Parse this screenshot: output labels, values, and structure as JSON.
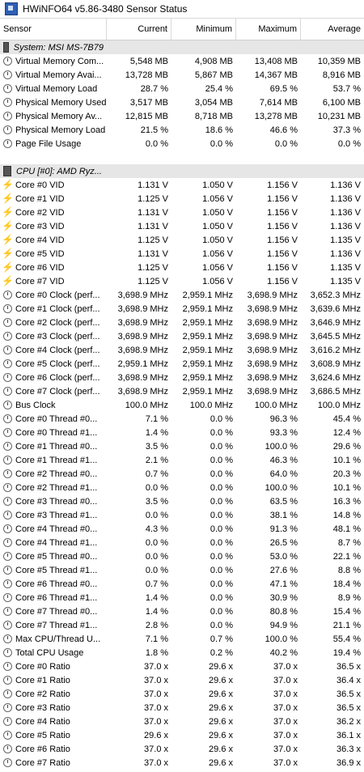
{
  "window": {
    "title": "HWiNFO64 v5.86-3480 Sensor Status"
  },
  "columns": {
    "sensor": "Sensor",
    "current": "Current",
    "minimum": "Minimum",
    "maximum": "Maximum",
    "average": "Average"
  },
  "rows": [
    {
      "type": "group",
      "label": "System: MSI MS-7B79"
    },
    {
      "type": "data",
      "icon": "clock-icon",
      "label": "Virtual Memory Com...",
      "current": "5,548 MB",
      "minimum": "4,908 MB",
      "maximum": "13,408 MB",
      "average": "10,359 MB"
    },
    {
      "type": "data",
      "icon": "clock-icon",
      "label": "Virtual Memory Avai...",
      "current": "13,728 MB",
      "minimum": "5,867 MB",
      "maximum": "14,367 MB",
      "average": "8,916 MB"
    },
    {
      "type": "data",
      "icon": "clock-icon",
      "label": "Virtual Memory Load",
      "current": "28.7 %",
      "minimum": "25.4 %",
      "maximum": "69.5 %",
      "average": "53.7 %"
    },
    {
      "type": "data",
      "icon": "clock-icon",
      "label": "Physical Memory Used",
      "current": "3,517 MB",
      "minimum": "3,054 MB",
      "maximum": "7,614 MB",
      "average": "6,100 MB"
    },
    {
      "type": "data",
      "icon": "clock-icon",
      "label": "Physical Memory Av...",
      "current": "12,815 MB",
      "minimum": "8,718 MB",
      "maximum": "13,278 MB",
      "average": "10,231 MB"
    },
    {
      "type": "data",
      "icon": "clock-icon",
      "label": "Physical Memory Load",
      "current": "21.5 %",
      "minimum": "18.6 %",
      "maximum": "46.6 %",
      "average": "37.3 %"
    },
    {
      "type": "data",
      "icon": "clock-icon",
      "label": "Page File Usage",
      "current": "0.0 %",
      "minimum": "0.0 %",
      "maximum": "0.0 %",
      "average": "0.0 %"
    },
    {
      "type": "blank"
    },
    {
      "type": "group",
      "label": "CPU [#0]: AMD Ryz..."
    },
    {
      "type": "data",
      "icon": "bolt-icon",
      "label": "Core #0 VID",
      "current": "1.131 V",
      "minimum": "1.050 V",
      "maximum": "1.156 V",
      "average": "1.136 V"
    },
    {
      "type": "data",
      "icon": "bolt-icon",
      "label": "Core #1 VID",
      "current": "1.125 V",
      "minimum": "1.056 V",
      "maximum": "1.156 V",
      "average": "1.136 V"
    },
    {
      "type": "data",
      "icon": "bolt-icon",
      "label": "Core #2 VID",
      "current": "1.131 V",
      "minimum": "1.050 V",
      "maximum": "1.156 V",
      "average": "1.136 V"
    },
    {
      "type": "data",
      "icon": "bolt-icon",
      "label": "Core #3 VID",
      "current": "1.131 V",
      "minimum": "1.050 V",
      "maximum": "1.156 V",
      "average": "1.136 V"
    },
    {
      "type": "data",
      "icon": "bolt-icon",
      "label": "Core #4 VID",
      "current": "1.125 V",
      "minimum": "1.050 V",
      "maximum": "1.156 V",
      "average": "1.135 V"
    },
    {
      "type": "data",
      "icon": "bolt-icon",
      "label": "Core #5 VID",
      "current": "1.131 V",
      "minimum": "1.056 V",
      "maximum": "1.156 V",
      "average": "1.136 V"
    },
    {
      "type": "data",
      "icon": "bolt-icon",
      "label": "Core #6 VID",
      "current": "1.125 V",
      "minimum": "1.056 V",
      "maximum": "1.156 V",
      "average": "1.135 V"
    },
    {
      "type": "data",
      "icon": "bolt-icon",
      "label": "Core #7 VID",
      "current": "1.125 V",
      "minimum": "1.056 V",
      "maximum": "1.156 V",
      "average": "1.135 V"
    },
    {
      "type": "data",
      "icon": "clock-icon",
      "label": "Core #0 Clock (perf...",
      "current": "3,698.9 MHz",
      "minimum": "2,959.1 MHz",
      "maximum": "3,698.9 MHz",
      "average": "3,652.3 MHz"
    },
    {
      "type": "data",
      "icon": "clock-icon",
      "label": "Core #1 Clock (perf...",
      "current": "3,698.9 MHz",
      "minimum": "2,959.1 MHz",
      "maximum": "3,698.9 MHz",
      "average": "3,639.6 MHz"
    },
    {
      "type": "data",
      "icon": "clock-icon",
      "label": "Core #2 Clock (perf...",
      "current": "3,698.9 MHz",
      "minimum": "2,959.1 MHz",
      "maximum": "3,698.9 MHz",
      "average": "3,646.9 MHz"
    },
    {
      "type": "data",
      "icon": "clock-icon",
      "label": "Core #3 Clock (perf...",
      "current": "3,698.9 MHz",
      "minimum": "2,959.1 MHz",
      "maximum": "3,698.9 MHz",
      "average": "3,645.5 MHz"
    },
    {
      "type": "data",
      "icon": "clock-icon",
      "label": "Core #4 Clock (perf...",
      "current": "3,698.9 MHz",
      "minimum": "2,959.1 MHz",
      "maximum": "3,698.9 MHz",
      "average": "3,616.2 MHz"
    },
    {
      "type": "data",
      "icon": "clock-icon",
      "label": "Core #5 Clock (perf...",
      "current": "2,959.1 MHz",
      "minimum": "2,959.1 MHz",
      "maximum": "3,698.9 MHz",
      "average": "3,608.9 MHz"
    },
    {
      "type": "data",
      "icon": "clock-icon",
      "label": "Core #6 Clock (perf...",
      "current": "3,698.9 MHz",
      "minimum": "2,959.1 MHz",
      "maximum": "3,698.9 MHz",
      "average": "3,624.6 MHz"
    },
    {
      "type": "data",
      "icon": "clock-icon",
      "label": "Core #7 Clock (perf...",
      "current": "3,698.9 MHz",
      "minimum": "2,959.1 MHz",
      "maximum": "3,698.9 MHz",
      "average": "3,686.5 MHz"
    },
    {
      "type": "data",
      "icon": "clock-icon",
      "label": "Bus Clock",
      "current": "100.0 MHz",
      "minimum": "100.0 MHz",
      "maximum": "100.0 MHz",
      "average": "100.0 MHz"
    },
    {
      "type": "data",
      "icon": "clock-icon",
      "label": "Core #0 Thread #0...",
      "current": "7.1 %",
      "minimum": "0.0 %",
      "maximum": "96.3 %",
      "average": "45.4 %"
    },
    {
      "type": "data",
      "icon": "clock-icon",
      "label": "Core #0 Thread #1...",
      "current": "1.4 %",
      "minimum": "0.0 %",
      "maximum": "93.3 %",
      "average": "12.4 %"
    },
    {
      "type": "data",
      "icon": "clock-icon",
      "label": "Core #1 Thread #0...",
      "current": "3.5 %",
      "minimum": "0.0 %",
      "maximum": "100.0 %",
      "average": "29.6 %"
    },
    {
      "type": "data",
      "icon": "clock-icon",
      "label": "Core #1 Thread #1...",
      "current": "2.1 %",
      "minimum": "0.0 %",
      "maximum": "46.3 %",
      "average": "10.1 %"
    },
    {
      "type": "data",
      "icon": "clock-icon",
      "label": "Core #2 Thread #0...",
      "current": "0.7 %",
      "minimum": "0.0 %",
      "maximum": "64.0 %",
      "average": "20.3 %"
    },
    {
      "type": "data",
      "icon": "clock-icon",
      "label": "Core #2 Thread #1...",
      "current": "0.0 %",
      "minimum": "0.0 %",
      "maximum": "100.0 %",
      "average": "10.1 %"
    },
    {
      "type": "data",
      "icon": "clock-icon",
      "label": "Core #3 Thread #0...",
      "current": "3.5 %",
      "minimum": "0.0 %",
      "maximum": "63.5 %",
      "average": "16.3 %"
    },
    {
      "type": "data",
      "icon": "clock-icon",
      "label": "Core #3 Thread #1...",
      "current": "0.0 %",
      "minimum": "0.0 %",
      "maximum": "38.1 %",
      "average": "14.8 %"
    },
    {
      "type": "data",
      "icon": "clock-icon",
      "label": "Core #4 Thread #0...",
      "current": "4.3 %",
      "minimum": "0.0 %",
      "maximum": "91.3 %",
      "average": "48.1 %"
    },
    {
      "type": "data",
      "icon": "clock-icon",
      "label": "Core #4 Thread #1...",
      "current": "0.0 %",
      "minimum": "0.0 %",
      "maximum": "26.5 %",
      "average": "8.7 %"
    },
    {
      "type": "data",
      "icon": "clock-icon",
      "label": "Core #5 Thread #0...",
      "current": "0.0 %",
      "minimum": "0.0 %",
      "maximum": "53.0 %",
      "average": "22.1 %"
    },
    {
      "type": "data",
      "icon": "clock-icon",
      "label": "Core #5 Thread #1...",
      "current": "0.0 %",
      "minimum": "0.0 %",
      "maximum": "27.6 %",
      "average": "8.8 %"
    },
    {
      "type": "data",
      "icon": "clock-icon",
      "label": "Core #6 Thread #0...",
      "current": "0.7 %",
      "minimum": "0.0 %",
      "maximum": "47.1 %",
      "average": "18.4 %"
    },
    {
      "type": "data",
      "icon": "clock-icon",
      "label": "Core #6 Thread #1...",
      "current": "1.4 %",
      "minimum": "0.0 %",
      "maximum": "30.9 %",
      "average": "8.9 %"
    },
    {
      "type": "data",
      "icon": "clock-icon",
      "label": "Core #7 Thread #0...",
      "current": "1.4 %",
      "minimum": "0.0 %",
      "maximum": "80.8 %",
      "average": "15.4 %"
    },
    {
      "type": "data",
      "icon": "clock-icon",
      "label": "Core #7 Thread #1...",
      "current": "2.8 %",
      "minimum": "0.0 %",
      "maximum": "94.9 %",
      "average": "21.1 %"
    },
    {
      "type": "data",
      "icon": "clock-icon",
      "label": "Max CPU/Thread U...",
      "current": "7.1 %",
      "minimum": "0.7 %",
      "maximum": "100.0 %",
      "average": "55.4 %"
    },
    {
      "type": "data",
      "icon": "clock-icon",
      "label": "Total CPU Usage",
      "current": "1.8 %",
      "minimum": "0.2 %",
      "maximum": "40.2 %",
      "average": "19.4 %"
    },
    {
      "type": "data",
      "icon": "clock-icon",
      "label": "Core #0 Ratio",
      "current": "37.0 x",
      "minimum": "29.6 x",
      "maximum": "37.0 x",
      "average": "36.5 x"
    },
    {
      "type": "data",
      "icon": "clock-icon",
      "label": "Core #1 Ratio",
      "current": "37.0 x",
      "minimum": "29.6 x",
      "maximum": "37.0 x",
      "average": "36.4 x"
    },
    {
      "type": "data",
      "icon": "clock-icon",
      "label": "Core #2 Ratio",
      "current": "37.0 x",
      "minimum": "29.6 x",
      "maximum": "37.0 x",
      "average": "36.5 x"
    },
    {
      "type": "data",
      "icon": "clock-icon",
      "label": "Core #3 Ratio",
      "current": "37.0 x",
      "minimum": "29.6 x",
      "maximum": "37.0 x",
      "average": "36.5 x"
    },
    {
      "type": "data",
      "icon": "clock-icon",
      "label": "Core #4 Ratio",
      "current": "37.0 x",
      "minimum": "29.6 x",
      "maximum": "37.0 x",
      "average": "36.2 x"
    },
    {
      "type": "data",
      "icon": "clock-icon",
      "label": "Core #5 Ratio",
      "current": "29.6 x",
      "minimum": "29.6 x",
      "maximum": "37.0 x",
      "average": "36.1 x"
    },
    {
      "type": "data",
      "icon": "clock-icon",
      "label": "Core #6 Ratio",
      "current": "37.0 x",
      "minimum": "29.6 x",
      "maximum": "37.0 x",
      "average": "36.3 x"
    },
    {
      "type": "data",
      "icon": "clock-icon",
      "label": "Core #7 Ratio",
      "current": "37.0 x",
      "minimum": "29.6 x",
      "maximum": "37.0 x",
      "average": "36.9 x"
    }
  ]
}
